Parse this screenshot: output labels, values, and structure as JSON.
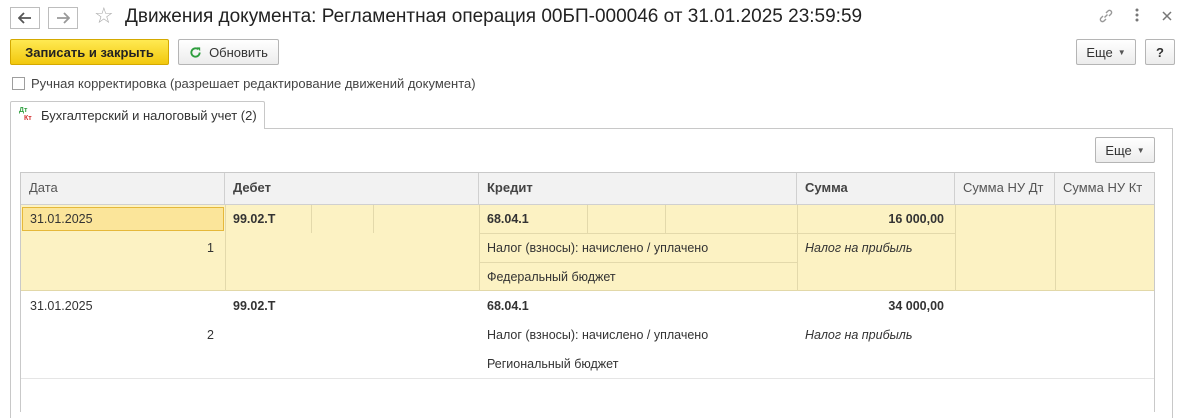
{
  "window": {
    "title": "Движения документа: Регламентная операция 00БП-000046 от 31.01.2025 23:59:59"
  },
  "toolbar": {
    "save_close_label": "Записать и закрыть",
    "refresh_label": "Обновить",
    "more_label": "Еще",
    "help_label": "?"
  },
  "manual_correction": {
    "label": "Ручная корректировка (разрешает редактирование движений документа)",
    "checked": false
  },
  "tabs": [
    {
      "label": "Бухгалтерский и налоговый учет (2)",
      "icon_text_top": "Дт",
      "icon_text_bottom": "Кт"
    }
  ],
  "table": {
    "more_label": "Еще",
    "columns": [
      "Дата",
      "Дебет",
      "Кредит",
      "Сумма",
      "Сумма НУ Дт",
      "Сумма НУ Кт"
    ],
    "rows": [
      {
        "date": "31.01.2025",
        "number": "1",
        "debit": "99.02.Т",
        "credit": "68.04.1",
        "credit_sub1": "Налог (взносы): начислено / уплачено",
        "credit_sub2": "Федеральный бюджет",
        "amount": "16 000,00",
        "amount_note": "Налог на прибыль"
      },
      {
        "date": "31.01.2025",
        "number": "2",
        "debit": "99.02.Т",
        "credit": "68.04.1",
        "credit_sub1": "Налог (взносы): начислено / уплачено",
        "credit_sub2": "Региональный бюджет",
        "amount": "34 000,00",
        "amount_note": "Налог на прибыль"
      }
    ]
  },
  "colors": {
    "primary_button": "#f5d01a",
    "selected_row": "#fcf2c3",
    "refresh_icon": "#2e9e3e"
  }
}
